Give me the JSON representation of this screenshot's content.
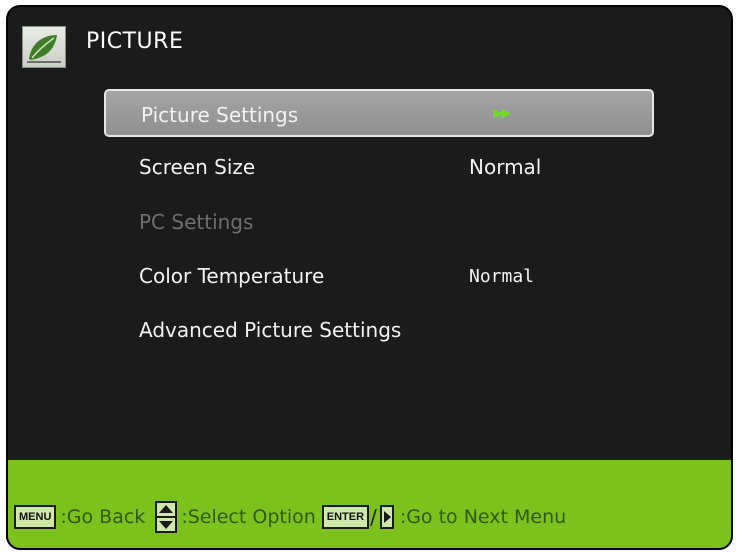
{
  "header": {
    "title": "PICTURE",
    "icon": "leaf-picture-icon"
  },
  "menu": {
    "items": [
      {
        "label": "Picture Settings",
        "value": "",
        "selected": true,
        "disabled": false,
        "icon": "double-arrow-right-icon"
      },
      {
        "label": "Screen Size",
        "value": "Normal",
        "selected": false,
        "disabled": false
      },
      {
        "label": "PC Settings",
        "value": "",
        "selected": false,
        "disabled": true
      },
      {
        "label": "Color Temperature",
        "value": "Normal",
        "selected": false,
        "disabled": false
      },
      {
        "label": "Advanced Picture Settings",
        "value": "",
        "selected": false,
        "disabled": false
      }
    ]
  },
  "footer": {
    "menu_key": "MENU",
    "menu_action": ":Go Back",
    "select_action": ":Select Option",
    "enter_key": "ENTER",
    "separator": "/",
    "enter_action": ":Go to Next Menu"
  },
  "colors": {
    "background": "#1b1b1b",
    "footer": "#7dc11c",
    "selection": "#9a9a9a",
    "accent_arrow": "#6fdc2a",
    "disabled_text": "#6e6e6e"
  }
}
